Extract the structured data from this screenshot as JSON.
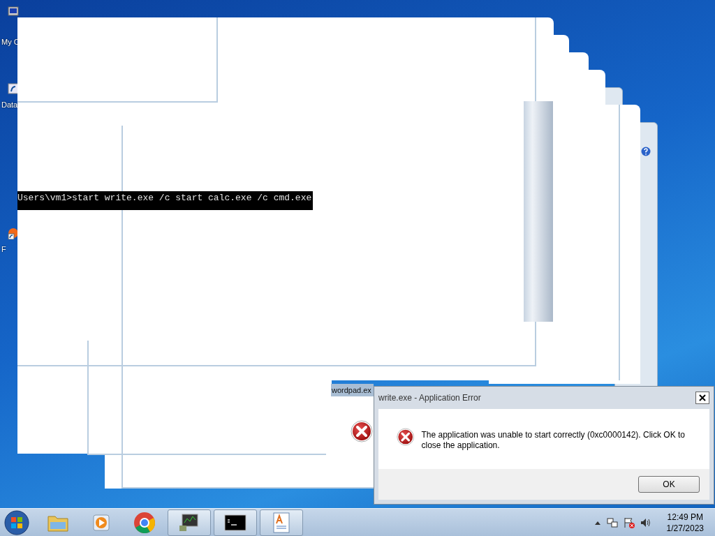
{
  "desktop": {
    "icons": [
      {
        "label": "My C",
        "kind": "computer"
      },
      {
        "label": "Data",
        "kind": "shortcut"
      },
      {
        "label": "F",
        "kind": "firefox"
      }
    ]
  },
  "console": {
    "command": "Users\\vm1>start write.exe /c start calc.exe /c cmd.exe"
  },
  "background_dialog": {
    "title": "wordpad.ex"
  },
  "error_dialog": {
    "title": "write.exe - Application Error",
    "message": "The application was unable to start correctly (0xc0000142). Click OK to close the application.",
    "buttons": [
      "OK"
    ]
  },
  "taskbar": {
    "items": [
      {
        "kind": "explorer",
        "active": false
      },
      {
        "kind": "media",
        "active": false
      },
      {
        "kind": "chrome",
        "active": false
      },
      {
        "kind": "monitor",
        "active": true
      },
      {
        "kind": "cmd",
        "active": true
      },
      {
        "kind": "wordpad",
        "active": true
      }
    ],
    "clock": {
      "time": "12:49 PM",
      "date": "1/27/2023"
    }
  }
}
